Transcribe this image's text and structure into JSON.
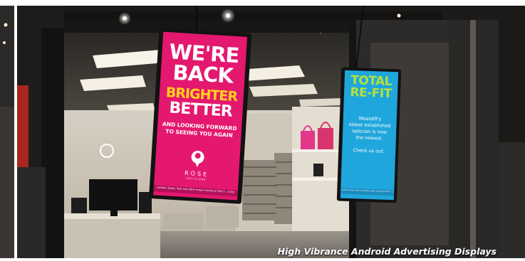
{
  "pink_display": {
    "headline": [
      "WE'RE",
      "BACK"
    ],
    "highlight": "BRIGHTER",
    "subhead": "BETTER",
    "tagline": [
      "AND LOOKING FORWARD",
      "TO SEEING YOU AGAIN"
    ],
    "brand": "ROSE",
    "brand_sub": "OPTICIANS",
    "ticker": "London, Essex, York and other areas moving to Tier 2 - 3 Dec",
    "bg_color": "#e4186e",
    "highlight_color": "#ffd21a"
  },
  "blue_display": {
    "headline": [
      "TOTAL",
      "RE-FIT"
    ],
    "body": [
      "Wealdiff's",
      "oldest established",
      "optician is now",
      "the newest."
    ],
    "cta": "Check us out.",
    "ticker": "London, Essex, York and other areas moving to Tier 2 - 3 Dec",
    "bg_color": "#1fa6dc",
    "headline_color": "#b7e13a"
  },
  "caption": "High Vibrance Android Advertising Displays"
}
